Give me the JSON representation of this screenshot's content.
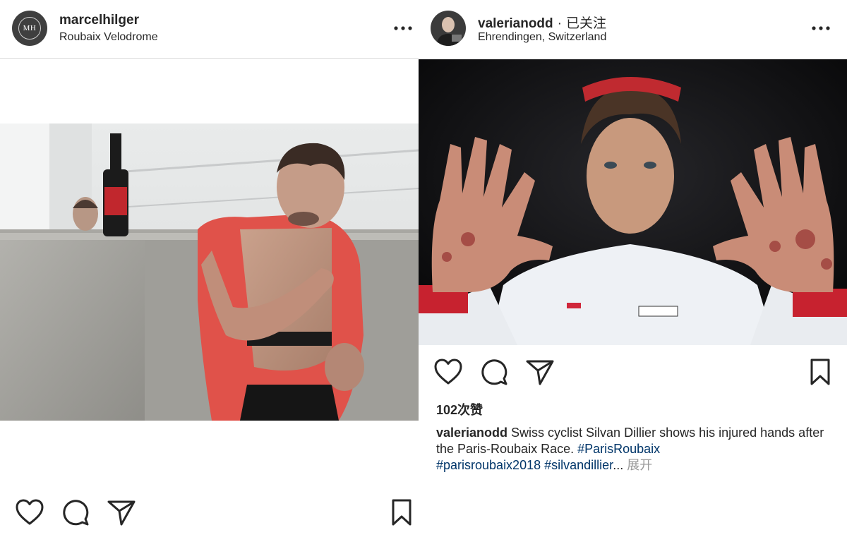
{
  "posts": [
    {
      "username": "marcelhilger",
      "location": "Roubaix Velodrome",
      "avatar_text": "MH"
    },
    {
      "username": "valerianodd",
      "separator": "·",
      "follow_status": "已关注",
      "location": "Ehrendingen, Switzerland",
      "likes": "102次赞",
      "caption": {
        "username": "valerianodd",
        "text": " Swiss cyclist Silvan Dillier shows his injured hands after the Paris-Roubaix Race.  ",
        "hashtags": [
          "#ParisRoubaix",
          "#parisroubaix2018",
          "#silvandillier"
        ],
        "ellipsis": "...",
        "more_label": "展开"
      }
    }
  ],
  "colors": {
    "text": "#262626",
    "secondary": "#999999",
    "hashtag": "#003569",
    "divider": "#dbdbdb"
  },
  "icons": [
    "more-options-icon",
    "heart-icon",
    "comment-icon",
    "share-icon",
    "bookmark-icon"
  ]
}
